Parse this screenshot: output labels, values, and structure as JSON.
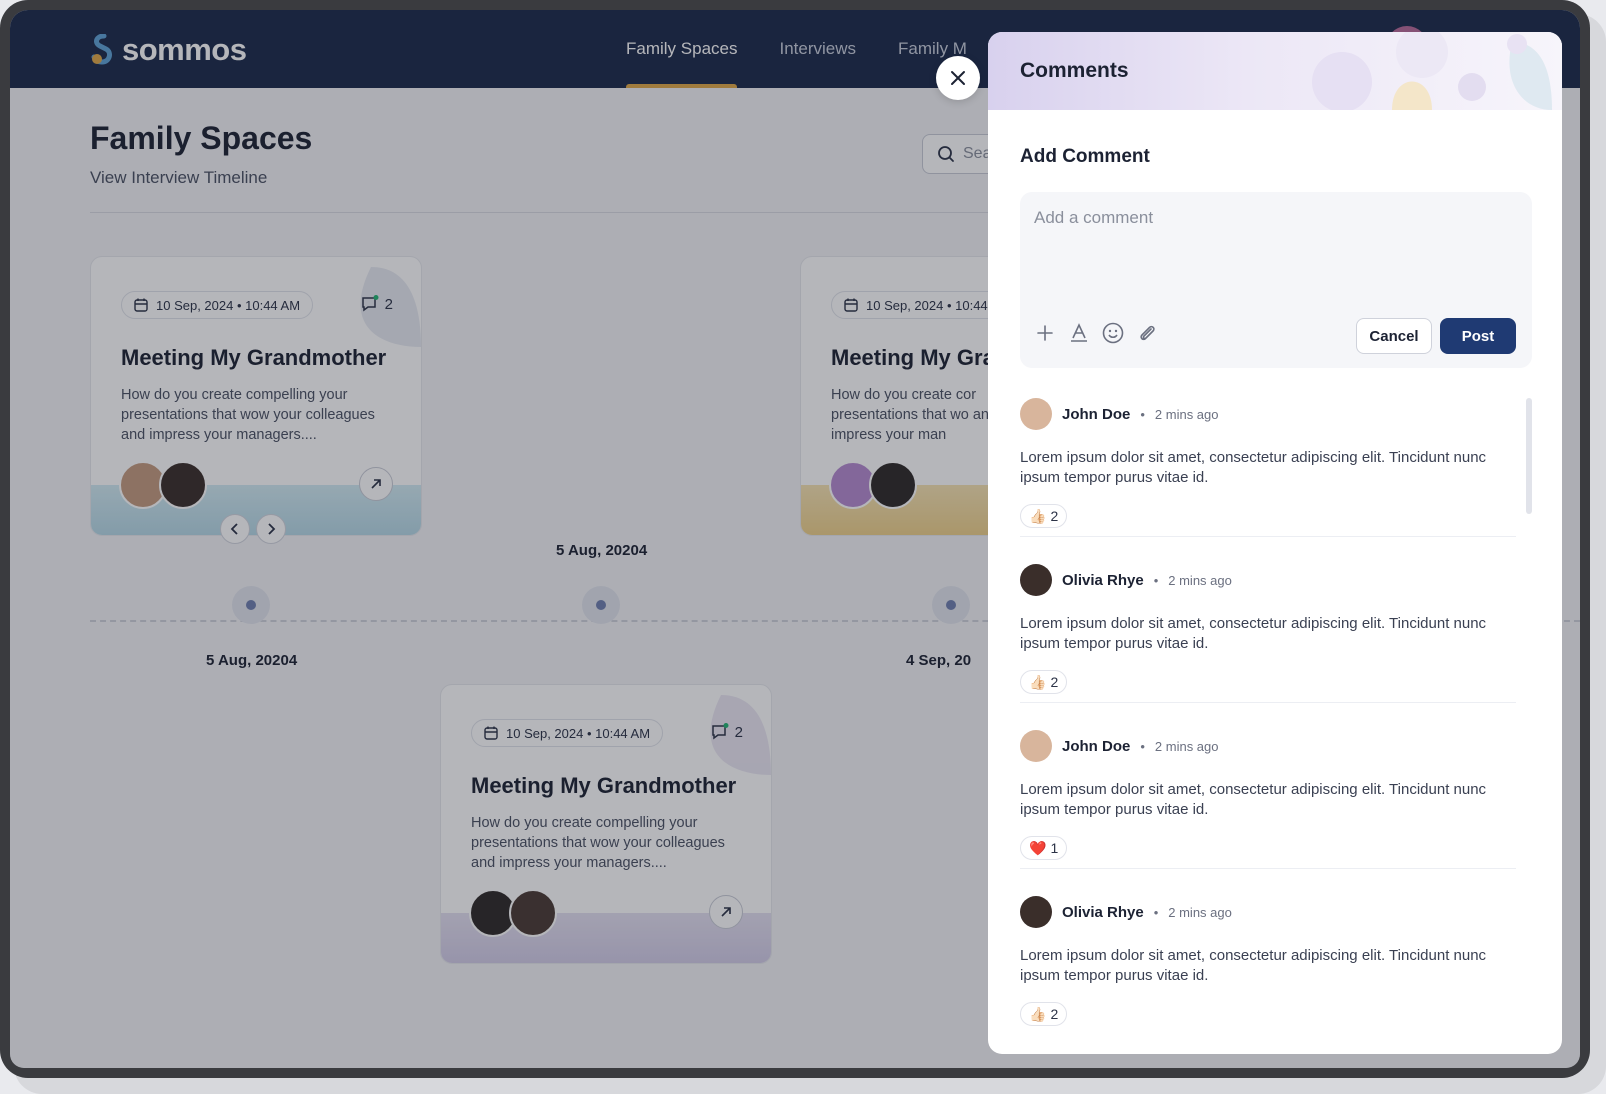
{
  "app": {
    "logo_text": "sommos"
  },
  "nav": {
    "items": [
      "Family Spaces",
      "Interviews",
      "Family M"
    ]
  },
  "page": {
    "title": "Family Spaces",
    "subtitle": "View Interview Timeline",
    "search_placeholder": "Sea"
  },
  "cards": [
    {
      "date": "10 Sep, 2024 • 10:44 AM",
      "comments": "2",
      "title": "Meeting My Grandmother",
      "desc": "How do you create compelling your presentations that wow your colleagues and impress your managers...."
    },
    {
      "date": "10 Sep, 2024 • 10:44 AM",
      "comments": "2",
      "title": "Meeting My Grandmother",
      "desc": "How do you create compelling your presentations that wow your colleagues and impress your managers...."
    },
    {
      "date": "10 Sep, 2024 • 10:44 A",
      "title": "Meeting My Gra",
      "desc": "How do you create cor presentations that wo and impress your man"
    }
  ],
  "timeline": {
    "date_top": "5 Aug, 20204",
    "date_left": "5 Aug, 20204",
    "date_right": "4 Sep, 20"
  },
  "panel": {
    "title": "Comments",
    "add_title": "Add Comment",
    "placeholder": "Add a comment",
    "cancel": "Cancel",
    "post": "Post",
    "comments": [
      {
        "name": "John Doe",
        "time": "2 mins ago",
        "text": "Lorem ipsum dolor sit amet, consectetur adipiscing elit. Tincidunt nunc ipsum tempor purus vitae id.",
        "reaction": "👍🏻",
        "count": "2"
      },
      {
        "name": "Olivia Rhye",
        "time": "2 mins ago",
        "text": "Lorem ipsum dolor sit amet, consectetur adipiscing elit. Tincidunt nunc ipsum tempor purus vitae id.",
        "reaction": "👍🏻",
        "count": "2"
      },
      {
        "name": "John Doe",
        "time": "2 mins ago",
        "text": "Lorem ipsum dolor sit amet, consectetur adipiscing elit. Tincidunt nunc ipsum tempor purus vitae id.",
        "reaction": "❤️",
        "count": "1"
      },
      {
        "name": "Olivia Rhye",
        "time": "2 mins ago",
        "text": "Lorem ipsum dolor sit amet, consectetur adipiscing elit. Tincidunt nunc ipsum tempor purus vitae id.",
        "reaction": "👍🏻",
        "count": "2"
      }
    ]
  },
  "colors": {
    "nav_bg": "#1b2a4a",
    "accent": "#e0a847",
    "primary_button": "#1f3a73"
  },
  "icons": [
    "calendar-icon",
    "comment-icon",
    "arrow-up-right-icon",
    "chevron-left-icon",
    "chevron-right-icon",
    "search-icon",
    "close-icon",
    "plus-icon",
    "text-format-icon",
    "emoji-icon",
    "attach-icon"
  ]
}
